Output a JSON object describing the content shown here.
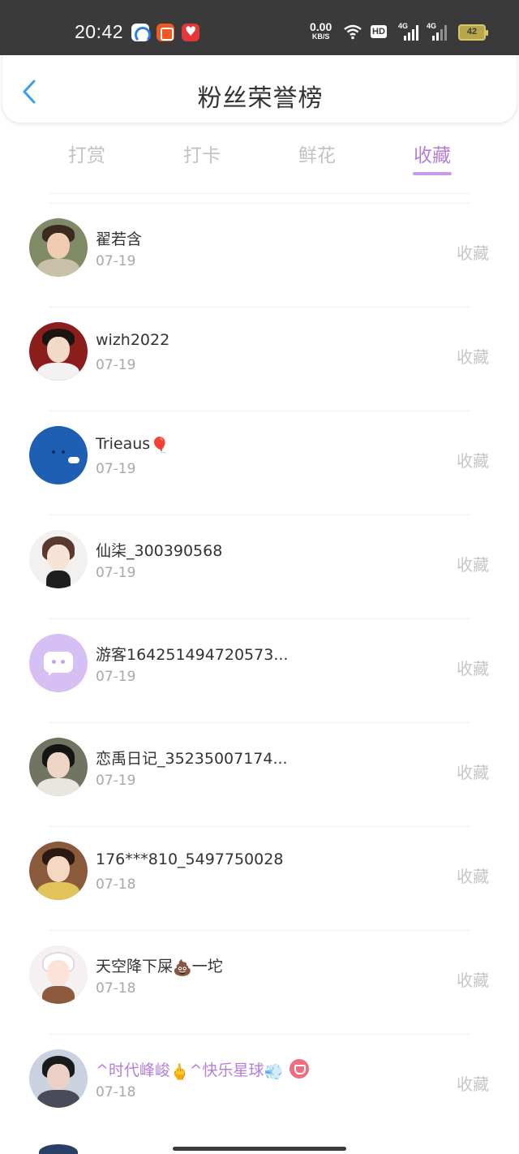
{
  "status_bar": {
    "time": "20:42",
    "net_speed_value": "0.00",
    "net_speed_unit": "KB/S",
    "hd_label": "HD",
    "sig1_label": "4G",
    "sig2_label": "4G",
    "battery": "42",
    "app_icons": [
      "browser-app-icon",
      "kuaishou-app-icon",
      "heart-app-icon"
    ]
  },
  "header": {
    "title": "粉丝荣誉榜",
    "back_icon": "chevron-left-icon"
  },
  "tabs": [
    {
      "label": "打赏",
      "active": false
    },
    {
      "label": "打卡",
      "active": false
    },
    {
      "label": "鲜花",
      "active": false
    },
    {
      "label": "收藏",
      "active": true
    }
  ],
  "colors": {
    "accent": "#b37fd8",
    "tab_inactive": "#c2c2c2",
    "action_text": "#c5c5c5",
    "date_text": "#a7a7a7"
  },
  "fans": [
    {
      "name": "翟若含",
      "date": "07-19",
      "action": "收藏"
    },
    {
      "name": "wizh2022",
      "date": "07-19",
      "action": "收藏"
    },
    {
      "name": "Trieaus",
      "name_emoji": "🎈",
      "date": "07-19",
      "action": "收藏"
    },
    {
      "name": "仙柒_300390568",
      "date": "07-19",
      "action": "收藏"
    },
    {
      "name": "游客164251494720573...",
      "date": "07-19",
      "action": "收藏"
    },
    {
      "name": "恋禹日记_35235007174...",
      "date": "07-19",
      "action": "收藏"
    },
    {
      "name": "176***810_5497750028",
      "date": "07-18",
      "action": "收藏"
    },
    {
      "name": "天空降下屎",
      "name_emoji": "💩",
      "name_suffix": "一坨",
      "date": "07-18",
      "action": "收藏"
    },
    {
      "name": "^时代峰峻",
      "name_emoji": "🖕",
      "name_suffix": "^快乐星球",
      "name_emoji2": "💨",
      "date": "07-18",
      "action": "收藏",
      "vip_badge": "gem-icon"
    }
  ]
}
